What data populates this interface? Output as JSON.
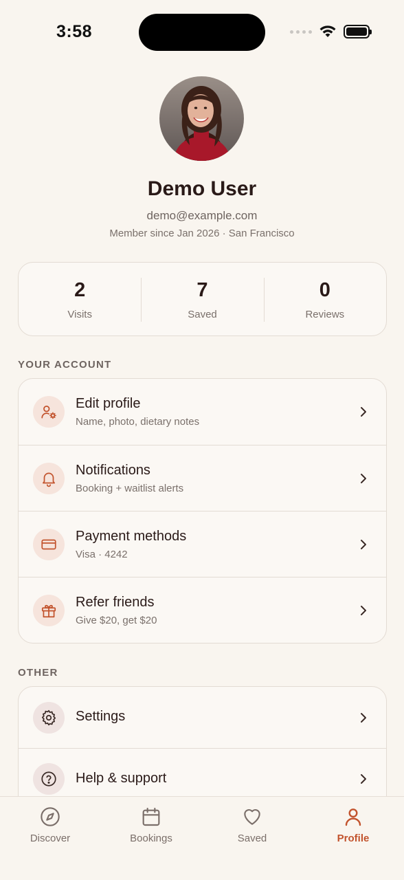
{
  "status_bar": {
    "time": "3:58"
  },
  "profile": {
    "name": "Demo User",
    "email": "demo@example.com",
    "meta": "Member since Jan 2026 · San Francisco"
  },
  "stats": [
    {
      "value": "2",
      "label": "Visits"
    },
    {
      "value": "7",
      "label": "Saved"
    },
    {
      "value": "0",
      "label": "Reviews"
    }
  ],
  "account": {
    "title": "YOUR ACCOUNT",
    "items": [
      {
        "label": "Edit profile",
        "sub": "Name, photo, dietary notes",
        "icon": "user-gear-icon"
      },
      {
        "label": "Notifications",
        "sub": "Booking + waitlist alerts",
        "icon": "bell-icon"
      },
      {
        "label": "Payment methods",
        "sub": "Visa · 4242",
        "icon": "credit-card-icon"
      },
      {
        "label": "Refer friends",
        "sub": "Give $20, get $20",
        "icon": "gift-icon"
      }
    ]
  },
  "other": {
    "title": "OTHER",
    "items": [
      {
        "label": "Settings",
        "icon": "gear-icon"
      },
      {
        "label": "Help & support",
        "icon": "help-circle-icon"
      }
    ]
  },
  "tabs": [
    {
      "label": "Discover",
      "icon": "compass-icon"
    },
    {
      "label": "Bookings",
      "icon": "calendar-icon"
    },
    {
      "label": "Saved",
      "icon": "heart-icon"
    },
    {
      "label": "Profile",
      "icon": "person-icon",
      "active": true
    }
  ],
  "colors": {
    "accent": "#c2532d",
    "background": "#f9f5ef",
    "icon_bg": "#f6e4dc"
  }
}
